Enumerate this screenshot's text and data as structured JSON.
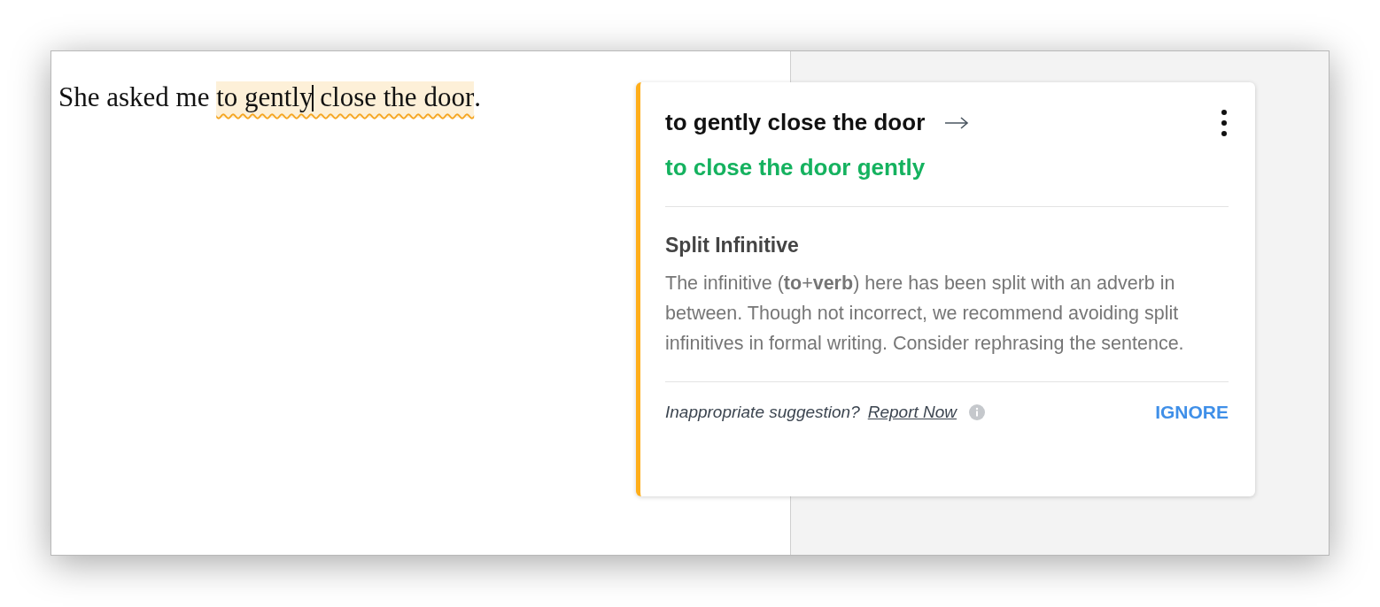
{
  "editor": {
    "before": "She asked me ",
    "flagged": "to gently close the door",
    "after": "."
  },
  "suggestion_card": {
    "original": "to gently close the door",
    "replacement": "to close the door gently",
    "title": "Split Infinitive",
    "description": "The infinitive (**to**+**verb**) here has been split with an adverb in between. Though not incorrect, we recommend avoiding split infinitives in formal writing. Consider rephrasing the sentence.",
    "report_prompt": "Inappropriate suggestion?",
    "report_link": "Report Now",
    "ignore_button": "IGNORE"
  }
}
